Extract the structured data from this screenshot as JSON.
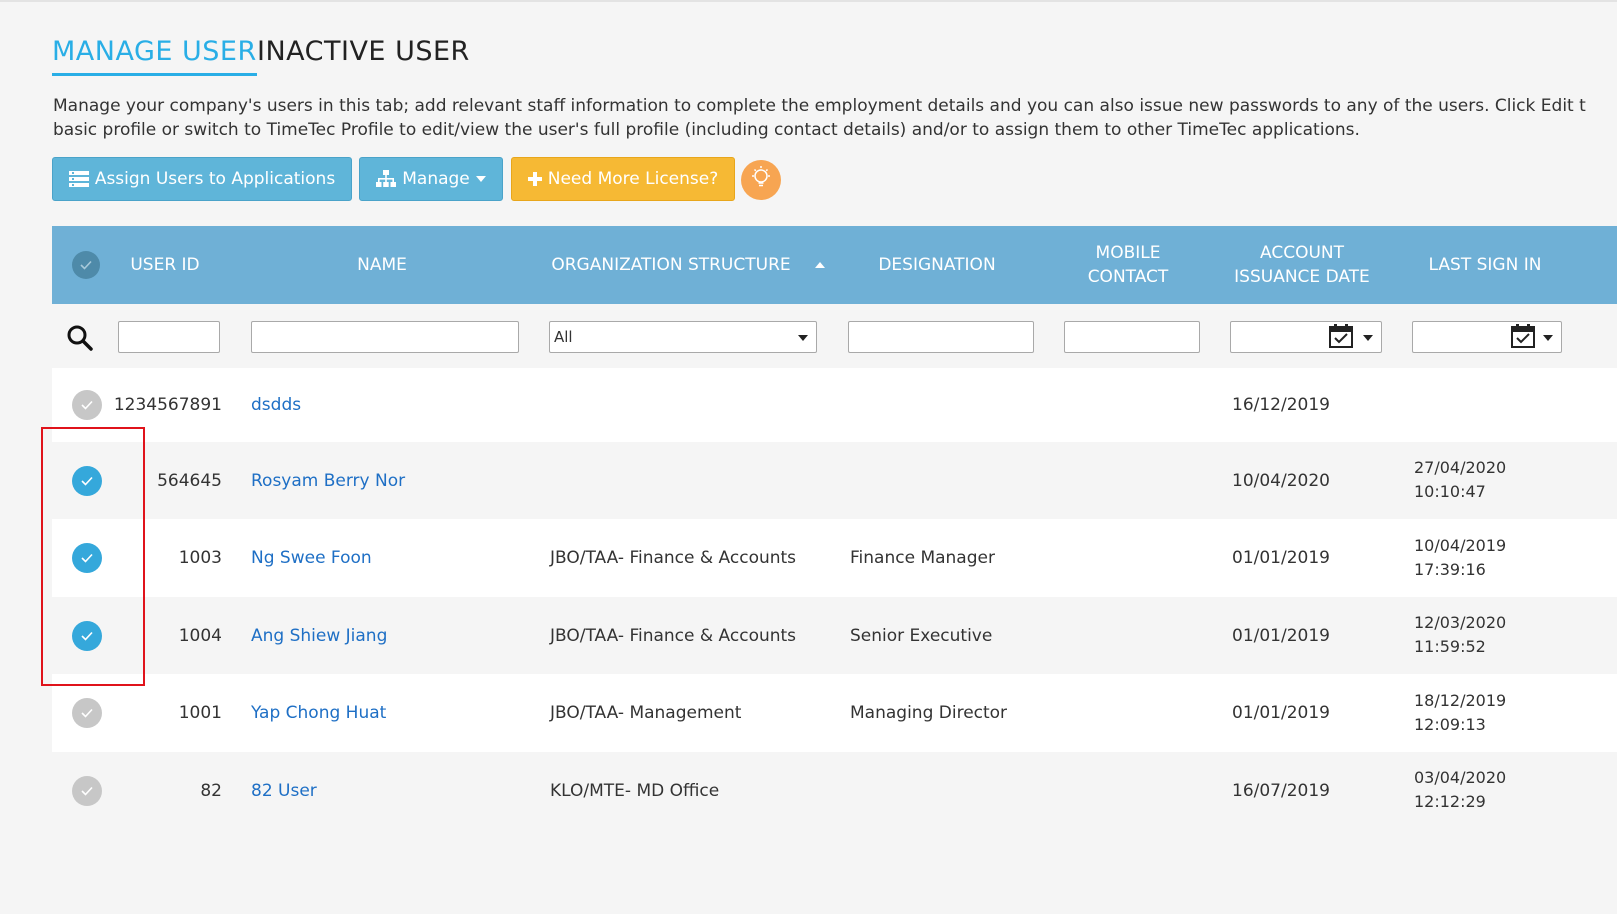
{
  "tabs": [
    {
      "label": "MANAGE USER"
    },
    {
      "label": "INACTIVE USER"
    }
  ],
  "description": {
    "line1": "Manage your company's users in this tab; add relevant staff information to complete the employment details and you can also issue new passwords to any of the users. Click Edit t",
    "line2": "basic profile or switch to TimeTec Profile to edit/view the user's full profile (including contact details) and/or to assign them to other TimeTec applications."
  },
  "toolbar": {
    "assign_label": "Assign Users to Applications",
    "manage_label": "Manage",
    "license_label": "Need More License?"
  },
  "table": {
    "headers": {
      "user_id": "USER ID",
      "name": "NAME",
      "org": "ORGANIZATION STRUCTURE",
      "designation": "DESIGNATION",
      "mobile_1": "MOBILE",
      "mobile_2": "CONTACT",
      "issuance_1": "ACCOUNT",
      "issuance_2": "ISSUANCE DATE",
      "last_sign_in": "LAST SIGN IN"
    },
    "filters": {
      "org_selected": "All"
    },
    "rows": [
      {
        "user_id": "1234567891",
        "name": "dsdds",
        "org": "",
        "designation": "",
        "mobile": "",
        "issuance": "16/12/2019",
        "last_date": "",
        "last_time": "",
        "checked": false
      },
      {
        "user_id": "564645",
        "name": "Rosyam Berry Nor",
        "org": "",
        "designation": "",
        "mobile": "",
        "issuance": "10/04/2020",
        "last_date": "27/04/2020",
        "last_time": "10:10:47",
        "checked": true
      },
      {
        "user_id": "1003",
        "name": "Ng Swee Foon",
        "org": "JBO/TAA- Finance & Accounts",
        "designation": "Finance Manager",
        "mobile": "",
        "issuance": "01/01/2019",
        "last_date": "10/04/2019",
        "last_time": "17:39:16",
        "checked": true
      },
      {
        "user_id": "1004",
        "name": "Ang Shiew Jiang",
        "org": "JBO/TAA- Finance & Accounts",
        "designation": "Senior Executive",
        "mobile": "",
        "issuance": "01/01/2019",
        "last_date": "12/03/2020",
        "last_time": "11:59:52",
        "checked": true
      },
      {
        "user_id": "1001",
        "name": "Yap Chong Huat",
        "org": "JBO/TAA- Management",
        "designation": "Managing Director",
        "mobile": "",
        "issuance": "01/01/2019",
        "last_date": "18/12/2019",
        "last_time": "12:09:13",
        "checked": false
      },
      {
        "user_id": "82",
        "name": "82 User",
        "org": "KLO/MTE- MD Office",
        "designation": "",
        "mobile": "",
        "issuance": "16/07/2019",
        "last_date": "03/04/2020",
        "last_time": "12:12:29",
        "checked": false
      }
    ]
  },
  "colors": {
    "accent": "#29aee6",
    "header_bg": "#6fb0d6",
    "button_blue": "#5fb5d9",
    "button_orange": "#f6b934",
    "link": "#1e6fc5",
    "check_on": "#35a8db",
    "highlight_box": "#e0131b"
  },
  "icons": {
    "assign": "list-icon",
    "manage": "sitemap-icon",
    "license": "plus-icon",
    "tip": "lightbulb-icon",
    "search": "search-icon",
    "calendar": "calendar-icon"
  }
}
